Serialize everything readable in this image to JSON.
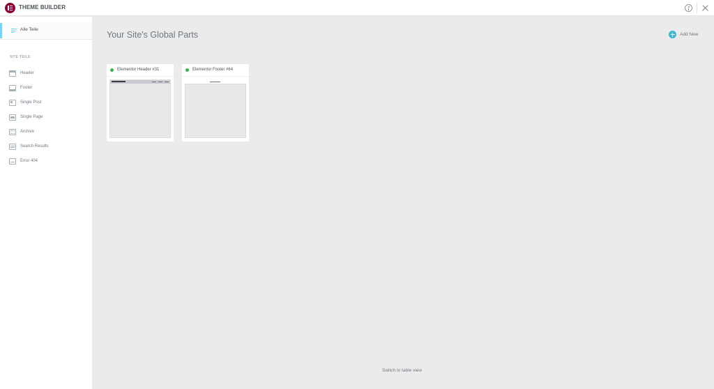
{
  "app": {
    "title": "THEME BUILDER"
  },
  "sidebar": {
    "all_parts_label": "Alle Teile",
    "section_heading": "SITE TEILE",
    "items": [
      {
        "label": "Header",
        "icon": "header-icon"
      },
      {
        "label": "Footer",
        "icon": "footer-icon"
      },
      {
        "label": "Single Post",
        "icon": "single-post-icon"
      },
      {
        "label": "Single Page",
        "icon": "single-page-icon"
      },
      {
        "label": "Archive",
        "icon": "archive-icon"
      },
      {
        "label": "Search Results",
        "icon": "search-results-icon"
      },
      {
        "label": "Error 404",
        "icon": "error-404-icon"
      }
    ]
  },
  "main": {
    "title": "Your Site's Global Parts",
    "add_new_label": "Add New",
    "switch_view_label": "Switch to table view",
    "cards": [
      {
        "title": "Elementor Header #31",
        "status": "published",
        "status_color": "#39b54a"
      },
      {
        "title": "Elementor Footer #64",
        "status": "published",
        "status_color": "#39b54a"
      }
    ]
  },
  "colors": {
    "brand": "#92003b",
    "accent": "#71d7f7",
    "add_button": "#39b9d7",
    "status_published": "#39b54a"
  }
}
